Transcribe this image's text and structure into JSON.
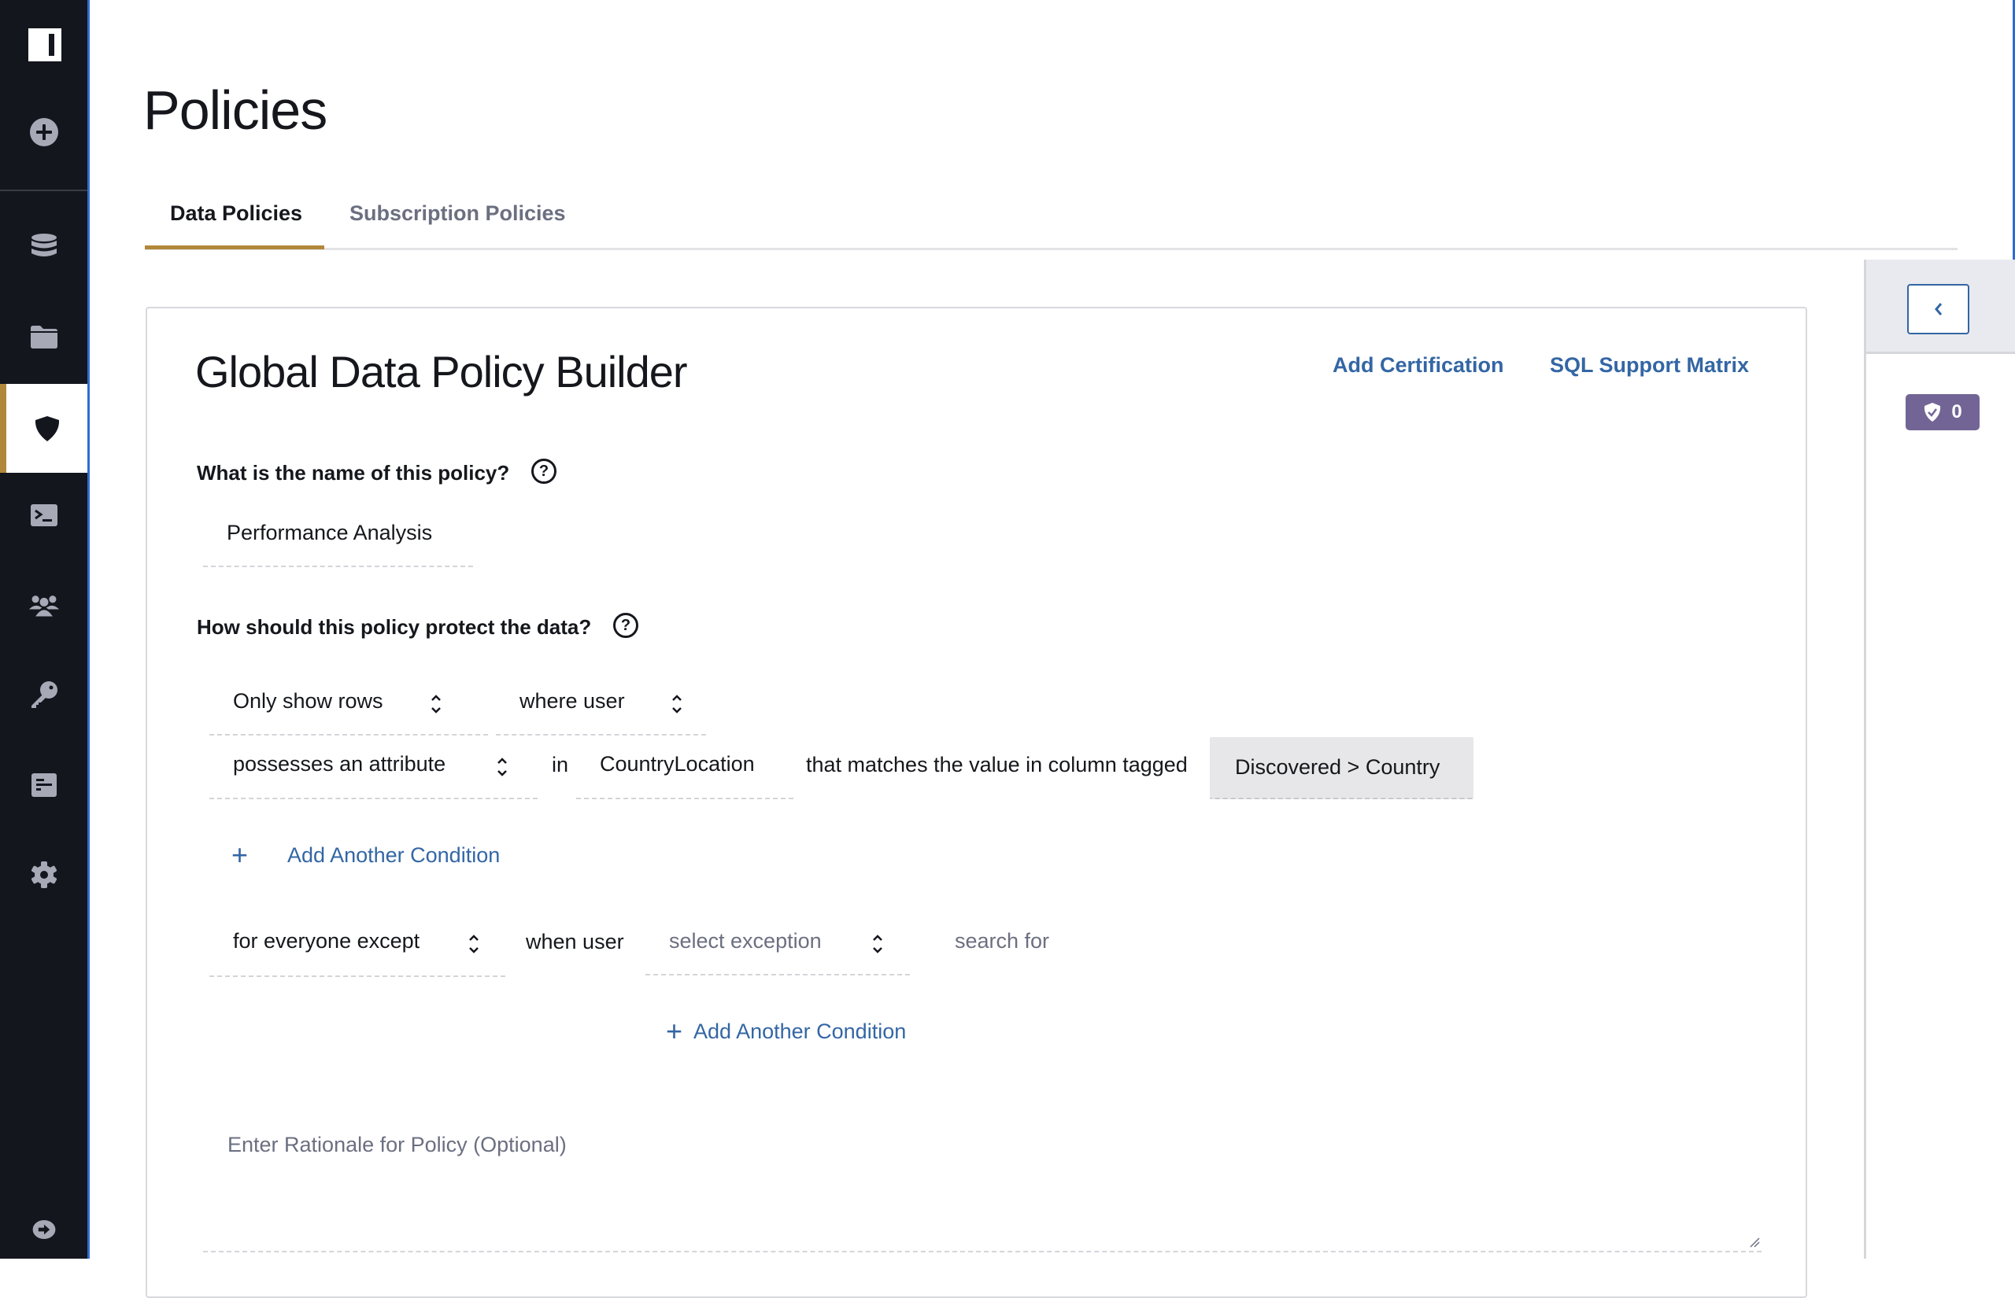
{
  "sidebar": {
    "items": [
      {
        "name": "logo",
        "icon": "logo-icon"
      },
      {
        "name": "create",
        "icon": "plus-circle-icon"
      },
      {
        "name": "data-sources",
        "icon": "database-icon"
      },
      {
        "name": "projects",
        "icon": "folder-icon"
      },
      {
        "name": "policies",
        "icon": "shield-icon",
        "active": true
      },
      {
        "name": "query-editor",
        "icon": "terminal-icon"
      },
      {
        "name": "users",
        "icon": "users-icon"
      },
      {
        "name": "keys",
        "icon": "key-icon"
      },
      {
        "name": "reports",
        "icon": "report-icon"
      },
      {
        "name": "settings",
        "icon": "gear-icon"
      },
      {
        "name": "logout",
        "icon": "arrow-right-circle-icon"
      }
    ]
  },
  "page": {
    "title": "Policies",
    "tabs": [
      {
        "label": "Data Policies",
        "active": true
      },
      {
        "label": "Subscription Policies",
        "active": false
      }
    ]
  },
  "builder": {
    "title": "Global Data Policy Builder",
    "links": {
      "add_certification": "Add Certification",
      "sql_support_matrix": "SQL Support Matrix"
    },
    "name_question": "What is the name of this policy?",
    "help_glyph": "?",
    "policy_name": "Performance Analysis",
    "protect_question": "How should this policy protect the data?",
    "rule": {
      "action": "Only show rows",
      "subject": "where user",
      "condition": "possesses an attribute",
      "in_word": "in",
      "attribute": "CountryLocation",
      "matches_text": "that matches the value in column tagged",
      "tag": "Discovered > Country"
    },
    "add_condition_label": "Add Another Condition",
    "plus_glyph": "+",
    "exception": {
      "scope": "for everyone except",
      "when_user": "when user",
      "select_placeholder": "select exception",
      "search_placeholder": "search for"
    },
    "rationale_placeholder": "Enter Rationale for Policy (Optional)"
  },
  "right_panel": {
    "collapse_icon": "chevron-left-icon",
    "certified_count": "0"
  },
  "colors": {
    "sidebar_bg": "#13161d",
    "accent_gold": "#b1873a",
    "link_blue": "#3366a4",
    "badge_purple": "#726596",
    "edge_blue": "#2f6bd0"
  }
}
